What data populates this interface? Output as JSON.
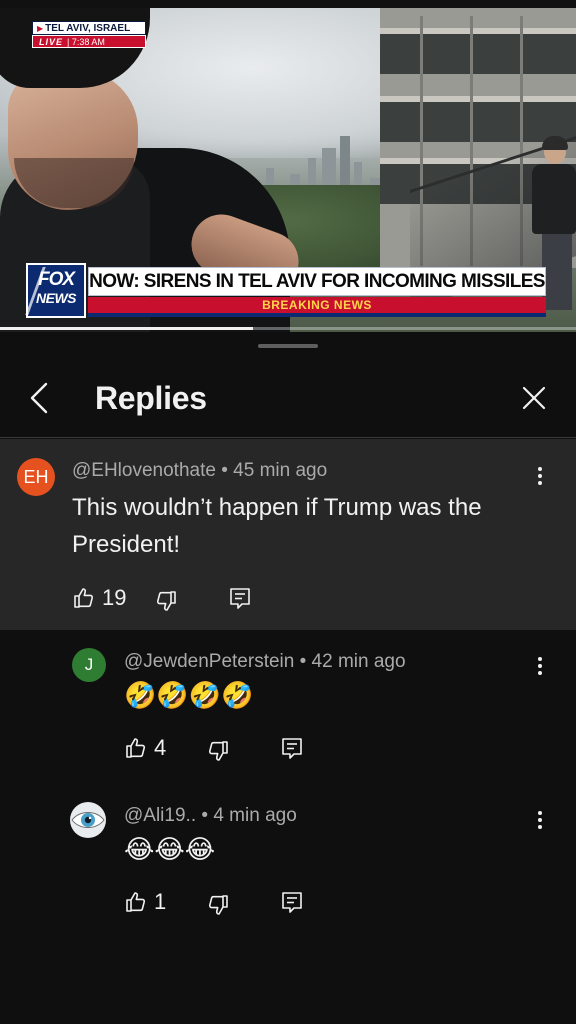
{
  "video": {
    "location_bug": {
      "location": "TEL AVIV, ISRAEL",
      "live_label": "LIVE",
      "time": "7:38 AM"
    },
    "logo": {
      "line1": "FOX",
      "line2": "NEWS"
    },
    "headline": "NOW: SIRENS IN TEL AVIV FOR INCOMING MISSILES",
    "banner": "BREAKING NEWS",
    "progress_fraction": 0.44
  },
  "sheet": {
    "title": "Replies",
    "back_icon": "chevron-left-icon",
    "close_icon": "close-icon"
  },
  "parent_comment": {
    "avatar_initials": "EH",
    "avatar_color": "#e6521f",
    "handle": "@EHlovenothate",
    "time": "45 min ago",
    "text": "This wouldn’t happen if Trump was the President!",
    "likes": "19"
  },
  "replies": [
    {
      "avatar_initials": "J",
      "avatar_color": "#2e7d32",
      "handle": "@JewdenPeterstein",
      "time": "42 min ago",
      "emoji": "🤣🤣🤣🤣",
      "likes": "4"
    },
    {
      "avatar_kind": "eye-image",
      "handle": "@Ali19..",
      "time": "4 min ago",
      "emoji": "😂😂😂",
      "likes": "1"
    }
  ],
  "separator": "•"
}
